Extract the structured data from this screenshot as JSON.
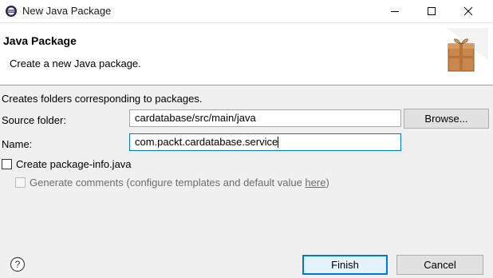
{
  "window": {
    "title": "New Java Package",
    "app_icon": "eclipse-icon",
    "controls": [
      "minimize-icon",
      "maximize-icon",
      "close-icon"
    ]
  },
  "header": {
    "title": "Java Package",
    "subtitle": "Create a new Java package.",
    "banner_icon": "package-wizard-icon"
  },
  "form": {
    "description": "Creates folders corresponding to packages.",
    "source_folder": {
      "label": "Source folder:",
      "value": "cardatabase/src/main/java",
      "browse_label": "Browse..."
    },
    "name": {
      "label": "Name:",
      "value": "com.packt.cardatabase.service"
    },
    "create_package_info": {
      "label": "Create package-info.java",
      "checked": false
    },
    "generate_comments": {
      "label": "Generate comments (configure templates and default value ",
      "link": "here",
      "suffix": ")",
      "checked": false,
      "enabled": false
    }
  },
  "footer": {
    "help_icon": "help-icon",
    "finish_label": "Finish",
    "cancel_label": "Cancel"
  },
  "colors": {
    "accent": "#0078d7",
    "dialog_bg": "#f0f0f0",
    "header_bg": "#ffffff"
  }
}
